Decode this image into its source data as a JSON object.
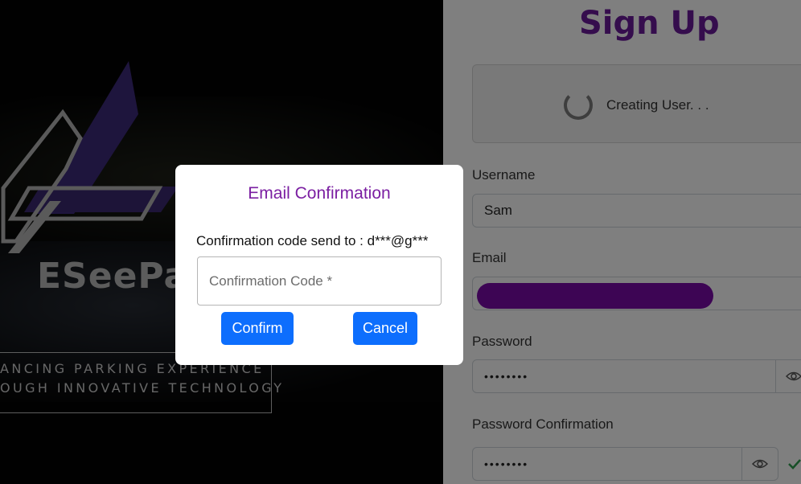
{
  "hero": {
    "brand": "ESeePa",
    "tagline_line1": "ANCING PARKING EXPERIENCE",
    "tagline_line2": "OUGH INNOVATIVE TECHNOLOGY"
  },
  "form": {
    "title": "Sign Up",
    "status_text": "Creating User. . .",
    "username_label": "Username",
    "username_value": "Sam",
    "email_label": "Email",
    "password_label": "Password",
    "password_value": "••••••••",
    "password_confirm_label": "Password Confirmation",
    "password_confirm_value": "••••••••"
  },
  "modal": {
    "title": "Email Confirmation",
    "info": "Confirmation code send to : d***@g***",
    "code_placeholder": "Confirmation Code *",
    "confirm_label": "Confirm",
    "cancel_label": "Cancel"
  },
  "colors": {
    "accent_purple": "#6a1b9a",
    "button_blue": "#0d6efd",
    "redaction": "#7a0aa8"
  },
  "icons": [
    "logo-icon",
    "spinner-icon",
    "eye-icon",
    "check-icon"
  ]
}
